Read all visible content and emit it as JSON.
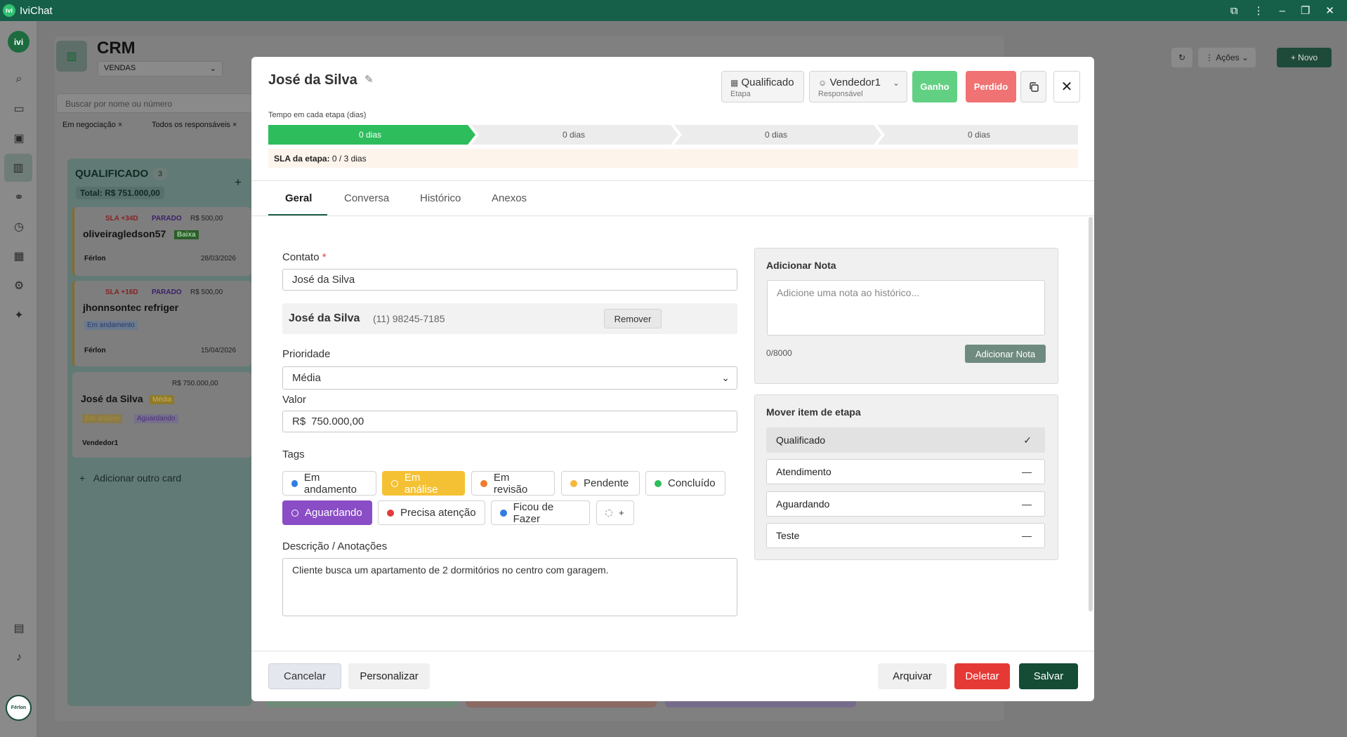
{
  "app": {
    "title": "IviChat",
    "logo_text": "ivi"
  },
  "sidebar": {
    "avatar": "ivi",
    "bottom_logo": "Férlon"
  },
  "background": {
    "page_title": "CRM",
    "pipeline_select": "VENDAS",
    "search_placeholder": "Buscar por nome ou número",
    "filter_chips": [
      "Em negociação ×",
      "Todos os responsáveis ×"
    ],
    "actions_label": "Ações",
    "new_label": "+ Novo",
    "column": {
      "title": "QUALIFICADO",
      "count": "3",
      "total": "Total: R$ 751.000,00",
      "add_card": "Adicionar outro card",
      "cards": [
        {
          "sla": "SLA +34D",
          "status": "PARADO",
          "value": "R$ 500,00",
          "name": "oliveiragledson57",
          "badge": "Baixa",
          "owner": "Férlon",
          "date": "28/03/2026"
        },
        {
          "sla": "SLA +16D",
          "status": "PARADO",
          "value": "R$ 500,00",
          "name": "jhonnsontec refriger",
          "badge": "Em andamento",
          "owner": "Férlon",
          "date": "15/04/2026"
        },
        {
          "value": "R$ 750.000,00",
          "name": "José da Silva",
          "badge": "Média",
          "tags": [
            "Em análise",
            "Aguardando"
          ],
          "owner": "Vendedor1"
        }
      ]
    }
  },
  "modal": {
    "title": "José da Silva",
    "stage_btn": {
      "value": "Qualificado",
      "label": "Etapa"
    },
    "owner_btn": {
      "value": "Vendedor1",
      "label": "Responsável"
    },
    "won_label": "Ganho",
    "lost_label": "Perdido",
    "time_label": "Tempo em cada etapa (dias)",
    "stage_times": [
      "0 dias",
      "0 dias",
      "0 dias",
      "0 dias"
    ],
    "sla_label": "SLA da etapa:",
    "sla_value": " 0 / 3 dias",
    "tabs": [
      "Geral",
      "Conversa",
      "Histórico",
      "Anexos"
    ],
    "contact_label": "Contato",
    "contact_value": "José da Silva",
    "contact_name": "José da Silva",
    "contact_phone": "(11) 98245-7185",
    "remove_label": "Remover",
    "priority_label": "Prioridade",
    "priority_value": "Média",
    "value_label": "Valor",
    "currency": "R$",
    "value_amount": "750.000,00",
    "tags_label": "Tags",
    "tags": [
      {
        "label": "Em andamento",
        "color": "#2f7de1"
      },
      {
        "label": "Em análise",
        "color": "#f5c134",
        "selected": true
      },
      {
        "label": "Em revisão",
        "color": "#f07b2a"
      },
      {
        "label": "Pendente",
        "color": "#f5b83a"
      },
      {
        "label": "Concluído",
        "color": "#2ebd5c"
      },
      {
        "label": "Aguardando",
        "color": "#8a4dc6",
        "selected": true
      },
      {
        "label": "Precisa atenção",
        "color": "#e23b3b"
      },
      {
        "label": "Ficou de Fazer",
        "color": "#2f7de1"
      },
      {
        "label": "+",
        "color": "#999999"
      }
    ],
    "desc_label": "Descrição / Anotações",
    "desc_value": "Cliente busca um apartamento de 2 dormitórios no centro com garagem.",
    "note_title": "Adicionar Nota",
    "note_placeholder": "Adicione uma nota ao histórico...",
    "note_count": "0/8000",
    "note_btn": "Adicionar Nota",
    "move_title": "Mover item de etapa",
    "move_stages": [
      "Qualificado",
      "Atendimento",
      "Aguardando",
      "Teste"
    ],
    "cancel_label": "Cancelar",
    "customize_label": "Personalizar",
    "archive_label": "Arquivar",
    "delete_label": "Deletar",
    "save_label": "Salvar"
  },
  "colors": {
    "brand": "#16604a",
    "won": "#62d083",
    "lost": "#f07272",
    "delete": "#e53935",
    "save": "#144c36",
    "active_stage": "#2ebd5c"
  }
}
